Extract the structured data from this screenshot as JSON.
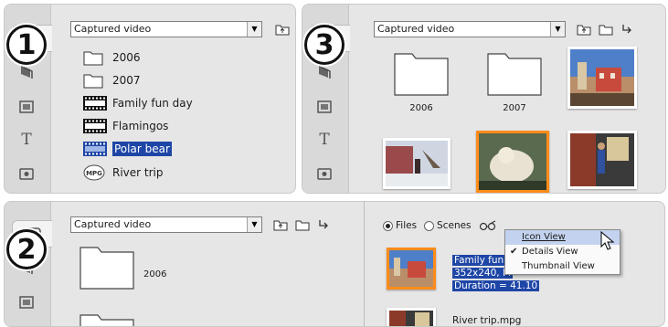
{
  "colors": {
    "selection": "#1e46a6",
    "selected_thumb_border": "#ff8c1a",
    "panel_bg": "#e6e6e6"
  },
  "panel1": {
    "badge": "1",
    "dropdown_value": "Captured video",
    "items": [
      {
        "label": "2006",
        "icon": "folder-icon"
      },
      {
        "label": "2007",
        "icon": "folder-icon"
      },
      {
        "label": "Family fun day",
        "icon": "film-icon"
      },
      {
        "label": "Flamingos",
        "icon": "film-icon"
      },
      {
        "label": "Polar bear",
        "icon": "film-icon",
        "selected": true
      },
      {
        "label": "River trip",
        "icon": "mpg-icon"
      }
    ]
  },
  "panel3": {
    "badge": "3",
    "dropdown_value": "Captured video",
    "folders": [
      "2006",
      "2007"
    ]
  },
  "panel2": {
    "badge": "2",
    "dropdown_value": "Captured video",
    "folder": "2006",
    "radio_files": "Files",
    "radio_scenes": "Scenes",
    "menu": [
      "Icon View",
      "Details View",
      "Thumbnail View"
    ],
    "menu_checked": "Details View",
    "details": [
      "Family fun d",
      "352x240, M",
      "Duration = 41.10"
    ],
    "river_trip": "River trip.mpg"
  }
}
